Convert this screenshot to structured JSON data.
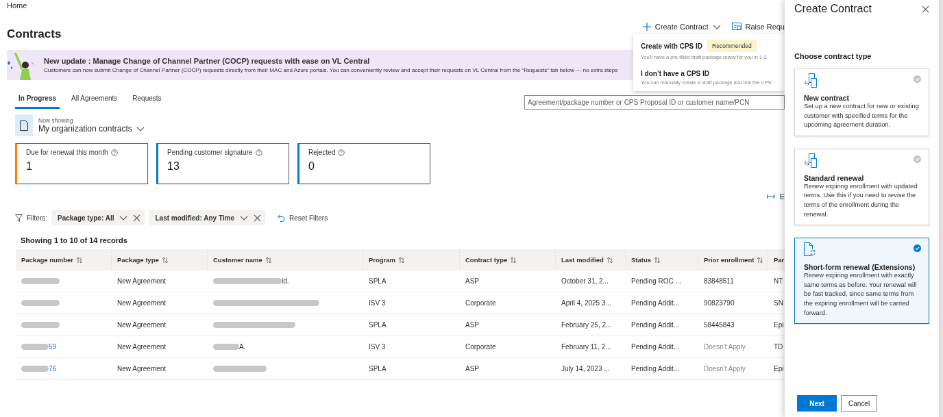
{
  "breadcrumb": "Home",
  "title": "Contracts",
  "toolbar": [
    {
      "kind": "create",
      "label": "Create Contract"
    },
    {
      "kind": "raise",
      "label": "Raise Requ"
    }
  ],
  "banner": {
    "title": "New update : Manage Change of Channel Partner (COCP) requests with ease on VL Central",
    "text": "Customers can now submit Change of Channel Partner (COCP) requests directly from their MAC and Azure portals. You can conveniently review and accept their requests on VL Central from the “Requests” tab below — no extra steps"
  },
  "tabs": [
    {
      "label": "In Progress",
      "selected": true
    },
    {
      "label": "All Agreements",
      "selected": false
    },
    {
      "label": "Requests",
      "selected": false
    }
  ],
  "view": {
    "caption": "Now showing",
    "value": "My organization contracts"
  },
  "search": {
    "placeholder": "Agreement/package number or CPS Proposal ID or customer name/PCN"
  },
  "summary_cards": [
    {
      "label": "Due for renewal this month",
      "value": "1",
      "color": "#f7830f"
    },
    {
      "label": "Pending customer signature",
      "value": "13",
      "color": "#0078d4"
    },
    {
      "label": "Rejected",
      "value": "0",
      "color": "#0078d4"
    }
  ],
  "export": {
    "label": "E"
  },
  "filters": {
    "label": "Filters:",
    "chips": [
      {
        "name": "Package type:",
        "value": "All"
      },
      {
        "name": "Last modified:",
        "value": "Any Time"
      }
    ],
    "reset": "Reset Filters"
  },
  "table": {
    "caption": "Showing 1 to 10 of 14 records",
    "columns": [
      "Package number",
      "Package type",
      "Customer name",
      "Program",
      "Contract type",
      "Last modified",
      "Status",
      "Prior enrollment",
      "Par"
    ],
    "rows": [
      {
        "package_number": {
          "redacted": true
        },
        "package_type": "New Agreement",
        "customer_name": {
          "redacted": true,
          "text": "ld."
        },
        "program": "SPLA",
        "contract_type": "ASP",
        "last_modified": "October 31, 2...",
        "status": "Pending ROC ...",
        "prior_enrollment": {
          "text": "83848511",
          "muted": false
        },
        "column_9": "NT"
      },
      {
        "package_number": {
          "redacted": true
        },
        "package_type": "New Agreement",
        "customer_name": {
          "redacted": true
        },
        "program": "ISV 3",
        "contract_type": "Corporate",
        "last_modified": "April 4, 2025 3...",
        "status": "Pending Addit...",
        "prior_enrollment": {
          "text": "90823790",
          "muted": false
        },
        "column_9": "SN"
      },
      {
        "package_number": {
          "redacted": true
        },
        "package_type": "New Agreement",
        "customer_name": {
          "redacted": true
        },
        "program": "SPLA",
        "contract_type": "ASP",
        "last_modified": "February 25, 2...",
        "status": "Pending Addit...",
        "prior_enrollment": {
          "text": "58445843",
          "muted": false
        },
        "column_9": "Epi"
      },
      {
        "package_number": {
          "redacted": true,
          "text": "59"
        },
        "package_type": "New Agreement",
        "customer_name": {
          "redacted": true,
          "text": "A."
        },
        "program": "ISV 3",
        "contract_type": "Corporate",
        "last_modified": "February 11, 2...",
        "status": "Pending Addit...",
        "prior_enrollment": {
          "text": "Doesn't Apply",
          "muted": true
        },
        "column_9": "TD"
      },
      {
        "package_number": {
          "redacted": true,
          "text": "76"
        },
        "package_type": "New Agreement",
        "customer_name": {
          "redacted": true
        },
        "program": "SPLA",
        "contract_type": "ASP",
        "last_modified": "July 14, 2023 ...",
        "status": "Pending Addit...",
        "prior_enrollment": {
          "text": "Doesn't Apply",
          "muted": true
        },
        "column_9": "Epi"
      }
    ]
  },
  "menu": {
    "items": [
      {
        "title": "Create with CPS ID",
        "badge": "Recommended",
        "text": "You'll have a pre-filled draft package ready for you in 1-2"
      },
      {
        "title": "I don’t have a CPS ID",
        "text": "You can manually create a draft package and link the CPS"
      }
    ]
  },
  "panel": {
    "title": "Create Contract",
    "subtitle": "Choose contract type",
    "options": [
      {
        "kind": "new",
        "title": "New contract",
        "text": "Set up a new contract for new or existing customer with specified terms for the upcoming agreement duration.",
        "selected": false
      },
      {
        "kind": "renewal",
        "title": "Standard renewal",
        "text": "Renew expiring enrollment with updated terms. Use this if you need to revise the terms of the enrollment during the renewal.",
        "selected": false
      },
      {
        "kind": "extension",
        "title": "Short-form renewal (Extensions)",
        "text": "Renew expiring enrollment with exactly same terms as before. Your renewal will be fast tracked, since same terms from the expiring enrollment will be carried forward.",
        "selected": true
      }
    ],
    "buttons": [
      {
        "kind": "primary",
        "label": "Next"
      },
      {
        "kind": "secondary",
        "label": "Cancel"
      }
    ]
  }
}
